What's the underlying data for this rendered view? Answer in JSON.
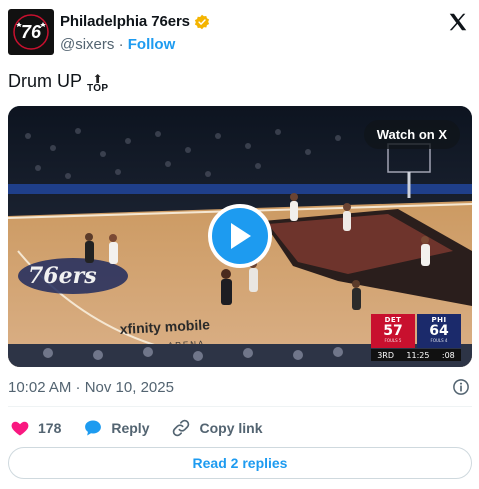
{
  "account": {
    "name": "Philadelphia 76ers",
    "handle": "@sixers",
    "separator": "·",
    "follow_label": "Follow",
    "avatar_text": "76",
    "verified_color": "#f4b400"
  },
  "tweet": {
    "text": "Drum UP",
    "emoji_label": "TOP",
    "emoji_name": "top-arrow-emoji"
  },
  "media": {
    "watch_label": "Watch on X",
    "court_logo": "76ers",
    "court_ad": "xfinity mobile",
    "court_ad_sub": "ARENA",
    "scoreboard": {
      "away_team": "DET",
      "away_score": "57",
      "home_team": "PHI",
      "home_score": "64",
      "away_fouls": "FOULS 5",
      "home_fouls": "FOULS 4",
      "period": "3RD",
      "clock": "11:25",
      "shot_clock": ":08"
    }
  },
  "meta": {
    "timestamp": "10:02 AM · Nov 10, 2025"
  },
  "actions": {
    "like_count": "178",
    "reply_label": "Reply",
    "copy_label": "Copy link",
    "read_replies_label": "Read 2 replies"
  },
  "colors": {
    "accent": "#1d9bf0",
    "like": "#f91880",
    "text_secondary": "#536471"
  }
}
